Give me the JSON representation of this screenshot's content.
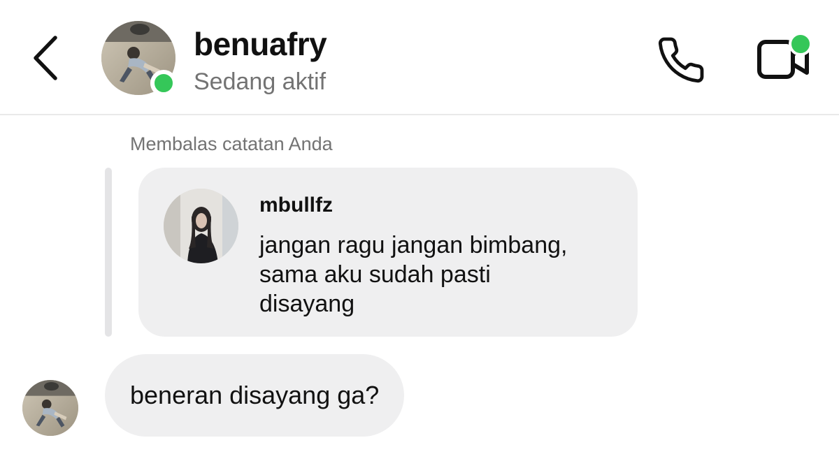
{
  "header": {
    "username": "benuafry",
    "status": "Sedang aktif"
  },
  "conversation": {
    "reply_caption": "Membalas catatan Anda",
    "quoted_note": {
      "username": "mbullfz",
      "text": "jangan ragu jangan bimbang,\nsama aku sudah pasti\ndisayang"
    },
    "messages": [
      {
        "text": "beneran disayang ga?"
      }
    ]
  },
  "colors": {
    "online": "#35c759",
    "bubble": "#efeff0",
    "secondary_text": "#737373",
    "divider": "#e9e9e9"
  },
  "icons": {
    "back": "chevron-left-icon",
    "call": "phone-icon",
    "video": "video-camera-icon"
  }
}
